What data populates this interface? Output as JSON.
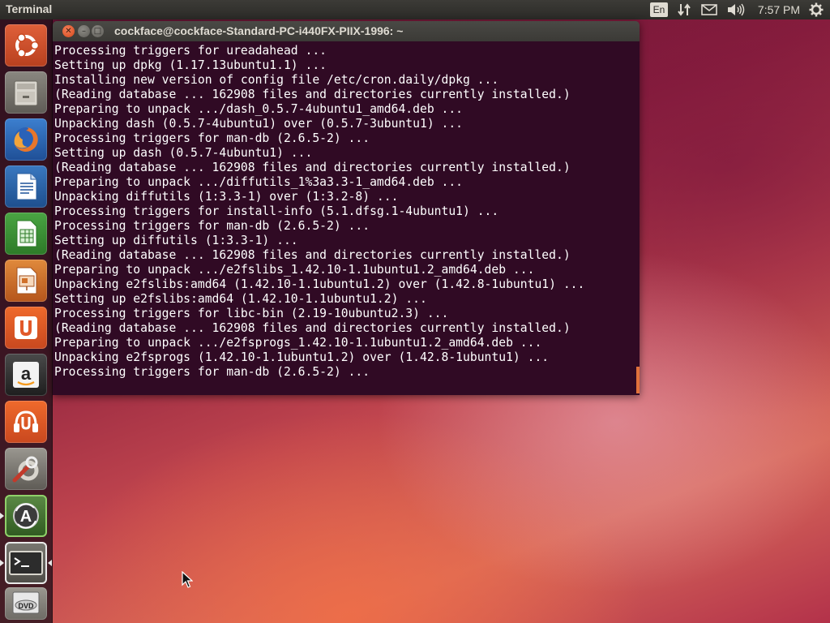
{
  "top_panel": {
    "title": "Terminal",
    "keyboard_layout": "En",
    "clock": "7:57 PM",
    "icons": [
      "network-icon",
      "mail-icon",
      "sound-icon",
      "session-gear-icon"
    ]
  },
  "launcher": {
    "items": [
      {
        "name": "ubuntu-dash",
        "icon": "ubuntu-logo-icon"
      },
      {
        "name": "files",
        "icon": "file-cabinet-icon"
      },
      {
        "name": "firefox",
        "icon": "firefox-icon"
      },
      {
        "name": "libreoffice-writer",
        "icon": "writer-document-icon"
      },
      {
        "name": "libreoffice-calc",
        "icon": "calc-spreadsheet-icon"
      },
      {
        "name": "libreoffice-impress",
        "icon": "impress-presentation-icon"
      },
      {
        "name": "ubuntu-software-center",
        "icon": "software-center-icon"
      },
      {
        "name": "amazon",
        "icon": "amazon-icon"
      },
      {
        "name": "ubuntu-one-music",
        "icon": "ubuntu-one-music-icon"
      },
      {
        "name": "system-settings",
        "icon": "settings-wrench-icon"
      },
      {
        "name": "software-updater",
        "icon": "software-updater-icon"
      },
      {
        "name": "terminal",
        "icon": "terminal-icon"
      },
      {
        "name": "dvd",
        "icon": "dvd-icon"
      }
    ]
  },
  "terminal": {
    "window_title": "cockface@cockface-Standard-PC-i440FX-PIIX-1996: ~",
    "lines": [
      "Processing triggers for ureadahead ...",
      "Setting up dpkg (1.17.13ubuntu1.1) ...",
      "Installing new version of config file /etc/cron.daily/dpkg ...",
      "(Reading database ... 162908 files and directories currently installed.)",
      "Preparing to unpack .../dash_0.5.7-4ubuntu1_amd64.deb ...",
      "Unpacking dash (0.5.7-4ubuntu1) over (0.5.7-3ubuntu1) ...",
      "Processing triggers for man-db (2.6.5-2) ...",
      "Setting up dash (0.5.7-4ubuntu1) ...",
      "(Reading database ... 162908 files and directories currently installed.)",
      "Preparing to unpack .../diffutils_1%3a3.3-1_amd64.deb ...",
      "Unpacking diffutils (1:3.3-1) over (1:3.2-8) ...",
      "Processing triggers for install-info (5.1.dfsg.1-4ubuntu1) ...",
      "Processing triggers for man-db (2.6.5-2) ...",
      "Setting up diffutils (1:3.3-1) ...",
      "(Reading database ... 162908 files and directories currently installed.)",
      "Preparing to unpack .../e2fslibs_1.42.10-1.1ubuntu1.2_amd64.deb ...",
      "Unpacking e2fslibs:amd64 (1.42.10-1.1ubuntu1.2) over (1.42.8-1ubuntu1) ...",
      "Setting up e2fslibs:amd64 (1.42.10-1.1ubuntu1.2) ...",
      "Processing triggers for libc-bin (2.19-10ubuntu2.3) ...",
      "(Reading database ... 162908 files and directories currently installed.)",
      "Preparing to unpack .../e2fsprogs_1.42.10-1.1ubuntu1.2_amd64.deb ...",
      "Unpacking e2fsprogs (1.42.10-1.1ubuntu1.2) over (1.42.8-1ubuntu1) ...",
      "Processing triggers for man-db (2.6.5-2) ..."
    ]
  },
  "colors": {
    "terminal_background": "#300a24",
    "terminal_text": "#ffffff",
    "panel_background": "#3c3b37",
    "close_button": "#e05a2b",
    "accent_orange": "#dd4814"
  }
}
